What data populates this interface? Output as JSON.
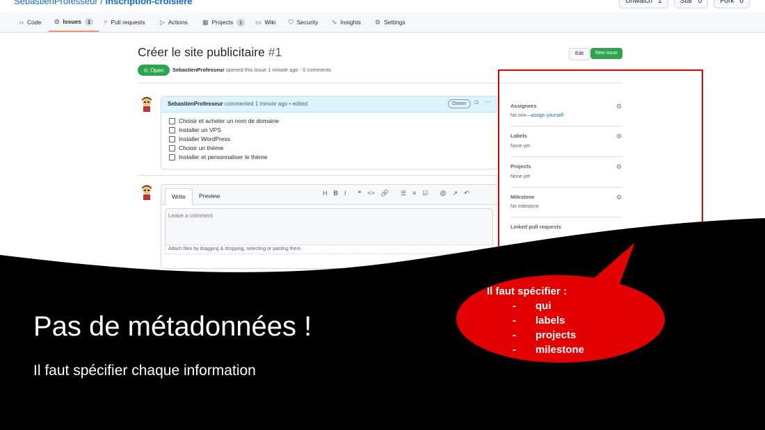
{
  "repo": {
    "owner": "SebastienProfesseur",
    "slash": " / ",
    "name": "inscription-croisiere"
  },
  "top_buttons": [
    {
      "label": "Unwatch",
      "count": "1"
    },
    {
      "label": "Star",
      "count": "0"
    },
    {
      "label": "Fork",
      "count": "0"
    }
  ],
  "tabs": [
    {
      "label": "Code",
      "icon": "code-icon"
    },
    {
      "label": "Issues",
      "count": "1",
      "icon": "issue-icon"
    },
    {
      "label": "Pull requests",
      "icon": "pull-request-icon"
    },
    {
      "label": "Actions",
      "icon": "play-icon"
    },
    {
      "label": "Projects",
      "count": "1",
      "icon": "table-icon"
    },
    {
      "label": "Wiki",
      "icon": "book-icon"
    },
    {
      "label": "Security",
      "icon": "shield-icon"
    },
    {
      "label": "Insights",
      "icon": "graph-icon"
    },
    {
      "label": "Settings",
      "icon": "gear-icon"
    }
  ],
  "issue": {
    "title": "Créer le site publicitaire",
    "number": "#1",
    "edit_label": "Edit",
    "new_issue_label": "New issue",
    "state": "Open",
    "author": "SebastienProfesseur",
    "meta": "opened this issue 1 minute ago · 0 comments"
  },
  "comment": {
    "author": "SebastienProfesseur",
    "meta": "commented 1 minute ago • edited",
    "owner_badge": "Owner",
    "tasks": [
      "Choisir et acheter un nom de domaine",
      "Installer un VPS",
      "Installer WordPress",
      "Choisir un thème",
      "Installer et personnaliser le thème"
    ]
  },
  "editor": {
    "write_tab": "Write",
    "preview_tab": "Preview",
    "toolbar": [
      "H",
      "B",
      "I",
      "❝",
      "<>",
      "🔗",
      "☰",
      "≡",
      "☑",
      "@",
      "↗",
      "↶"
    ],
    "placeholder": "Leave a comment",
    "attach": "Attach files by dragging & dropping, selecting or pasting them."
  },
  "sidebar": {
    "assignees": {
      "heading": "Assignees",
      "value_prefix": "No one—",
      "value_link": "assign yourself"
    },
    "labels": {
      "heading": "Labels",
      "value": "None yet"
    },
    "projects": {
      "heading": "Projects",
      "value": "None yet"
    },
    "milestone": {
      "heading": "Milestone",
      "value": "No milestone"
    },
    "linked": {
      "heading": "Linked pull requests"
    }
  },
  "slide": {
    "title": "Pas de métadonnées !",
    "subtitle": "Il faut spécifier chaque information"
  },
  "callout": {
    "heading": "Il faut spécifier :",
    "items": [
      "qui",
      "labels",
      "projects",
      "milestone"
    ]
  },
  "colors": {
    "accent_red": "#e30000",
    "open_green": "#2da44e",
    "link_blue": "#0969da"
  }
}
